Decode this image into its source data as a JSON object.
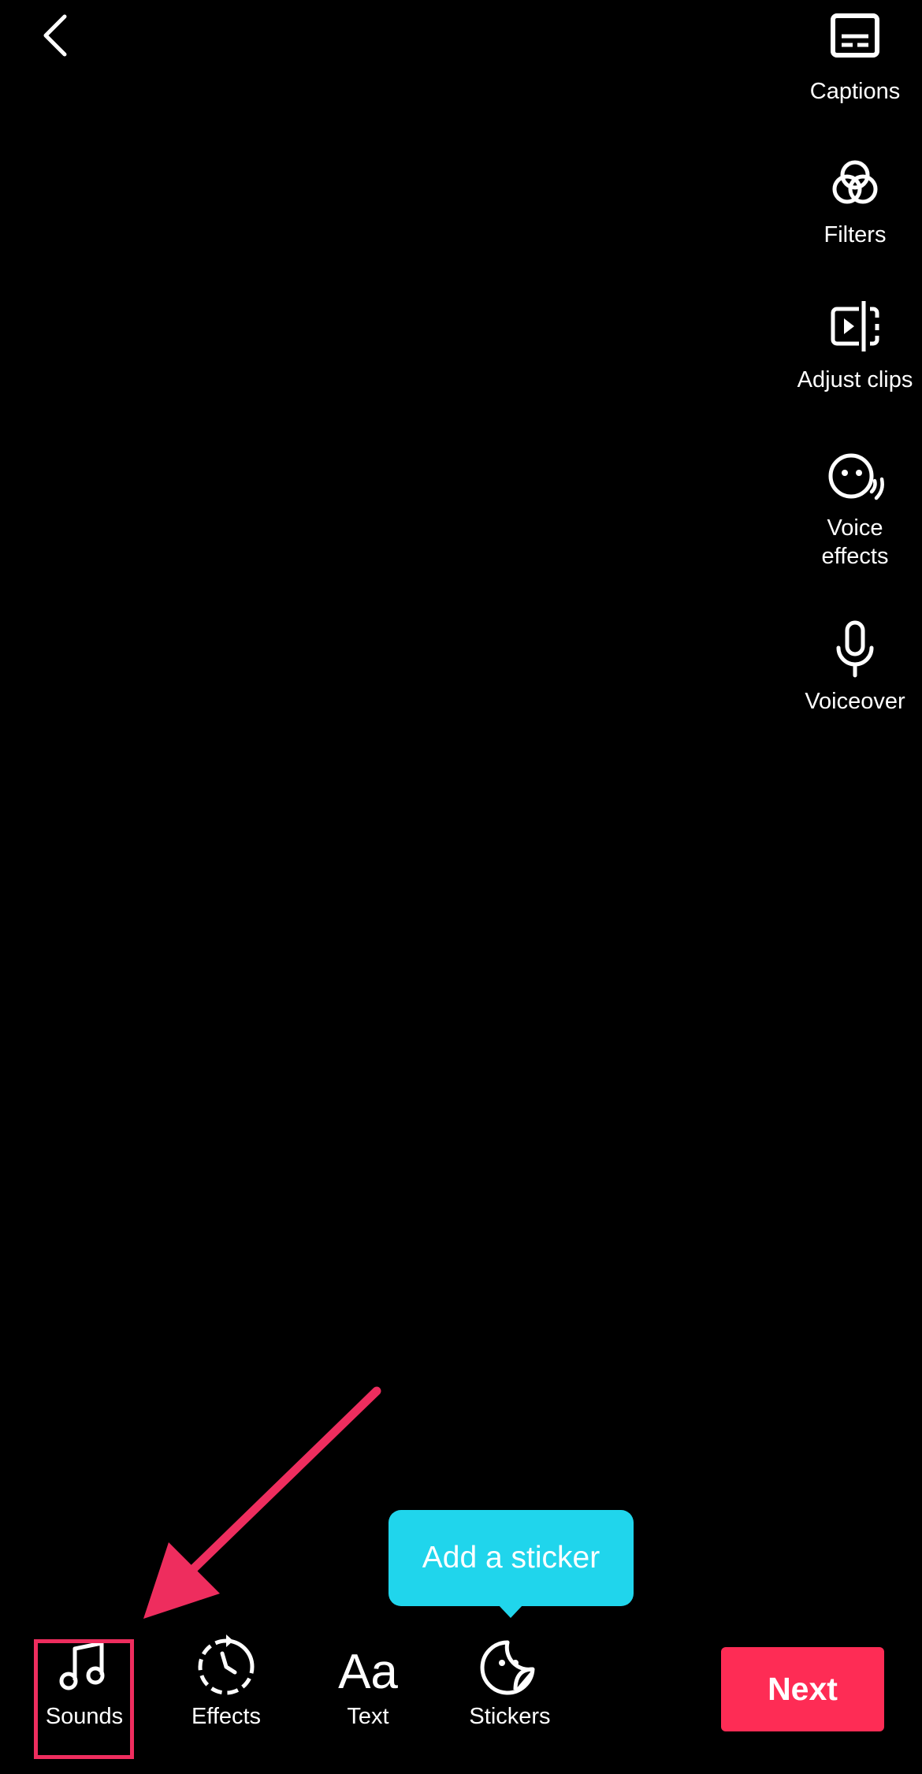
{
  "header": {
    "back_icon": "chevron-left-icon"
  },
  "side_tools": [
    {
      "label": "Captions",
      "icon": "captions-icon"
    },
    {
      "label": "Filters",
      "icon": "filters-icon"
    },
    {
      "label": "Adjust clips",
      "icon": "adjust-clips-icon"
    },
    {
      "label": "Voice\neffects",
      "icon": "voice-effects-icon"
    },
    {
      "label": "Voiceover",
      "icon": "microphone-icon"
    }
  ],
  "bottom_tools": [
    {
      "label": "Sounds",
      "icon": "music-note-icon"
    },
    {
      "label": "Effects",
      "icon": "effects-timer-icon"
    },
    {
      "label": "Text",
      "icon": "text-aa-icon"
    },
    {
      "label": "Stickers",
      "icon": "sticker-icon"
    }
  ],
  "tooltip": {
    "text": "Add a sticker"
  },
  "next_button": {
    "label": "Next"
  },
  "colors": {
    "background": "#000000",
    "next_button": "#fe2c55",
    "tooltip": "#20d5ec",
    "annotation": "#ee2d5e"
  }
}
